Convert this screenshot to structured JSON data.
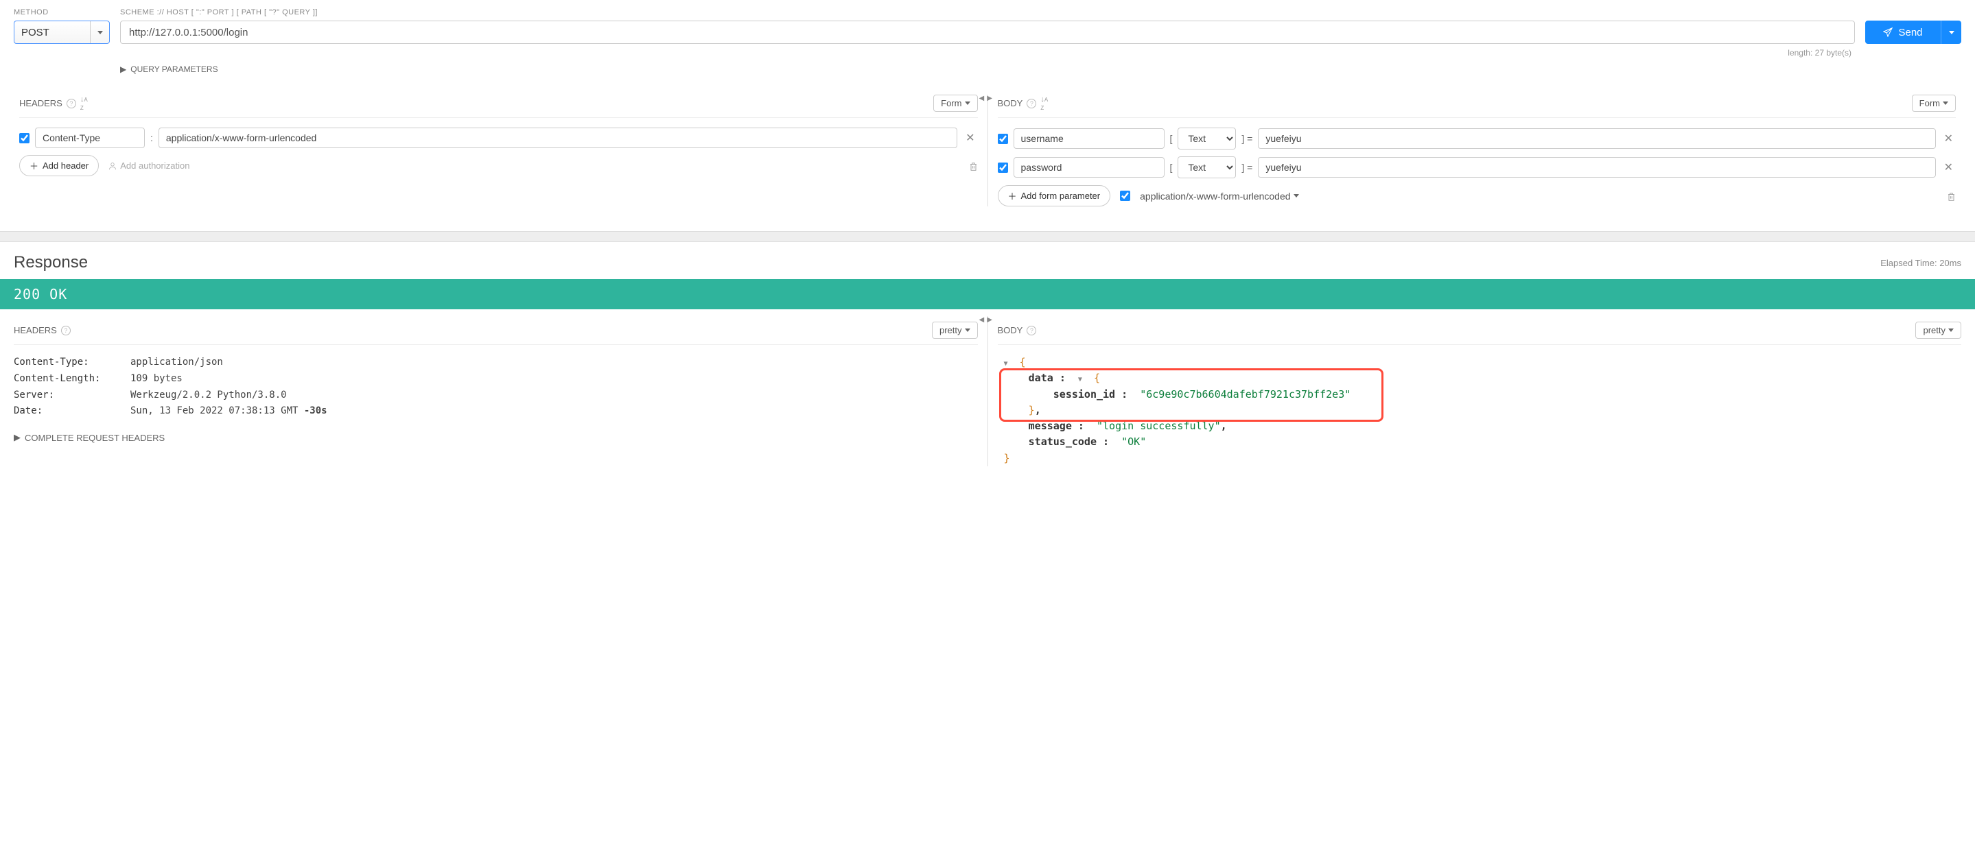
{
  "labels": {
    "method": "METHOD",
    "url": "SCHEME :// HOST [ \":\" PORT ] [ PATH [ \"?\" QUERY ]]",
    "query_params": "QUERY PARAMETERS",
    "headers": "HEADERS",
    "body": "BODY",
    "form": "Form",
    "add_header": "Add header",
    "add_auth": "Add authorization",
    "add_form_param": "Add form parameter",
    "send": "Send",
    "response": "Response",
    "elapsed": "Elapsed Time: 20ms",
    "pretty": "pretty",
    "complete_headers": "COMPLETE REQUEST HEADERS",
    "length": "length: 27 byte(s)"
  },
  "request": {
    "method": "POST",
    "url": "http://127.0.0.1:5000/login",
    "headers": [
      {
        "enabled": true,
        "name": "Content-Type",
        "value": "application/x-www-form-urlencoded"
      }
    ],
    "body_params": [
      {
        "enabled": true,
        "name": "username",
        "type": "Text",
        "value": "yuefeiyu"
      },
      {
        "enabled": true,
        "name": "password",
        "type": "Text",
        "value": "yuefeiyu"
      }
    ],
    "body_encoding_enabled": true,
    "body_encoding": "application/x-www-form-urlencoded"
  },
  "response": {
    "status_code": "200",
    "status_text": "OK",
    "headers": [
      {
        "key": "Content-Type:",
        "value": "application/json"
      },
      {
        "key": "Content-Length:",
        "value": "109 bytes"
      },
      {
        "key": "Server:",
        "value": "Werkzeug/2.0.2 Python/3.8.0"
      },
      {
        "key": "Date:",
        "value": "Sun, 13 Feb 2022 07:38:13 GMT",
        "suffix": "-30s"
      }
    ],
    "json": {
      "data_key": "data",
      "session_id_key": "session_id",
      "session_id_val": "\"6c9e90c7b6604dafebf7921c37bff2e3\"",
      "message_key": "message",
      "message_val": "\"login successfully\"",
      "status_code_key": "status_code",
      "status_code_val": "\"OK\""
    }
  }
}
